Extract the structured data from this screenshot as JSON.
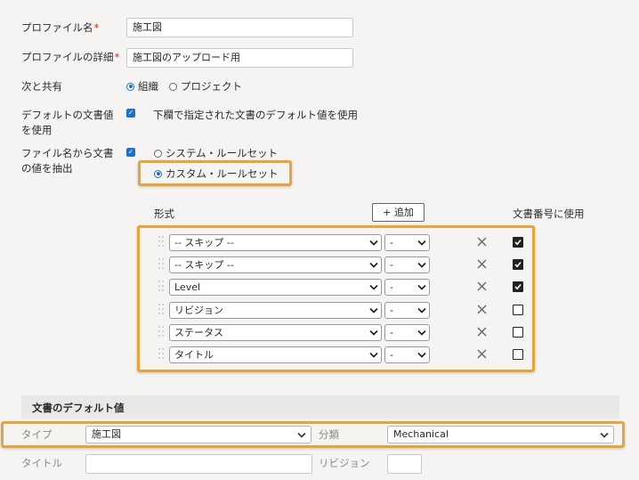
{
  "profile": {
    "name_label": "プロファイル名",
    "name_value": "施工図",
    "detail_label": "プロファイルの詳細",
    "detail_value": "施工図のアップロード用",
    "required_mark": "*"
  },
  "share": {
    "label": "次と共有",
    "option_org": "組織",
    "option_project": "プロジェクト",
    "selected": "組織"
  },
  "default_doc": {
    "label_line1": "デフォルトの文書値",
    "label_line2": "を使用",
    "checked": true,
    "description": "下欄で指定された文書のデフォルト値を使用"
  },
  "extract": {
    "label_line1": "ファイル名から文書",
    "label_line2": "の値を抽出",
    "checked": true,
    "option_system": "システム・ルールセット",
    "option_custom": "カスタム・ルールセット",
    "selected": "カスタム・ルールセット"
  },
  "rules": {
    "format_header": "形式",
    "add_button": "+ 追加",
    "use_header": "文書番号に使用",
    "rows": [
      {
        "field": "-- スキップ --",
        "sep": "-",
        "use": true
      },
      {
        "field": "-- スキップ --",
        "sep": "-",
        "use": true
      },
      {
        "field": "Level",
        "sep": "-",
        "use": true
      },
      {
        "field": "リビジョン",
        "sep": "-",
        "use": false
      },
      {
        "field": "ステータス",
        "sep": "-",
        "use": false
      },
      {
        "field": "タイトル",
        "sep": "-",
        "use": false
      }
    ]
  },
  "defaults": {
    "section_title": "文書のデフォルト値",
    "type_label": "タイプ",
    "type_value": "施工図",
    "category_label": "分類",
    "category_value": "Mechanical",
    "title_label": "タイトル",
    "title_value": "",
    "revision_label": "リビジョン",
    "revision_value": ""
  },
  "colors": {
    "highlight": "#e8a33a",
    "accent": "#1f6fd1",
    "required": "#d12b2b"
  }
}
